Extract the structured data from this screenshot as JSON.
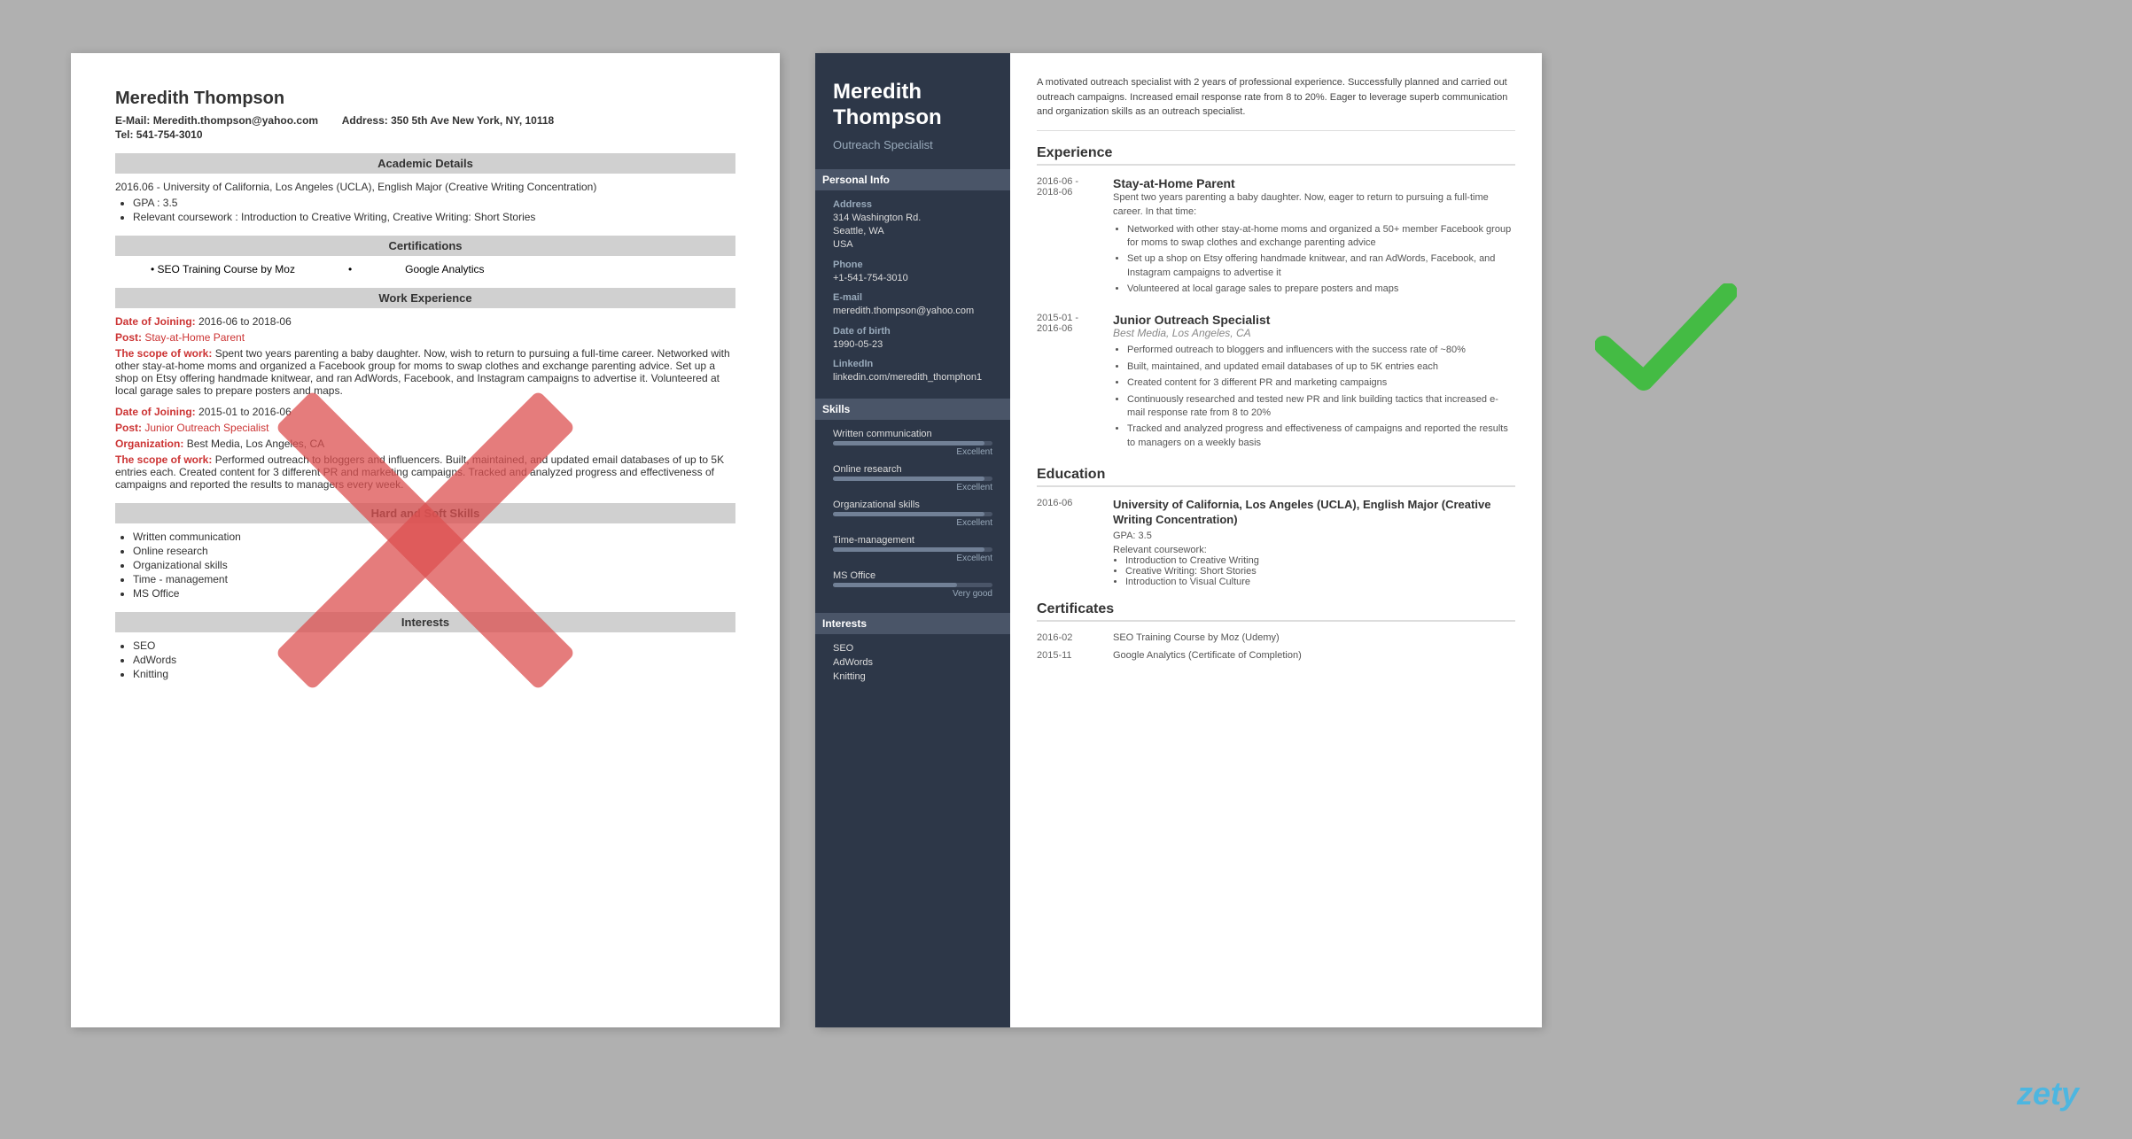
{
  "left_resume": {
    "name": "Meredith Thompson",
    "email_label": "E-Mail:",
    "email": "Meredith.thompson@yahoo.com",
    "address_label": "Address:",
    "address": "350 5th Ave New York, NY, 10118",
    "tel_label": "Tel:",
    "tel": "541-754-3010",
    "sections": {
      "academic": "Academic Details",
      "certifications": "Certifications",
      "work_experience": "Work Experience",
      "hard_soft_skills": "Hard and Soft Skills",
      "interests": "Interests"
    },
    "academic_details": "2016.06 - University of California, Los Angeles (UCLA), English Major (Creative Writing Concentration)",
    "gpa": "GPA : 3.5",
    "coursework": "Relevant coursework : Introduction to Creative Writing, Creative Writing: Short Stories",
    "certs": [
      "SEO Training Course by Moz",
      "Google Analytics"
    ],
    "work": [
      {
        "date_label": "Date of Joining:",
        "date": "2016-06 to 2018-06",
        "post_label": "Post:",
        "post": "Stay-at-Home Parent",
        "scope_label": "The scope of work:",
        "scope": "Spent two years parenting a baby daughter. Now, wish to return to pursuing a full-time career. Networked with other stay-at-home moms and organized a Facebook group for moms to swap clothes and exchange parenting advice. Set up a shop on Etsy offering handmade knitwear, and ran AdWords, Facebook, and Instagram campaigns to advertise it. Volunteered at local garage sales to prepare posters and maps."
      },
      {
        "date_label": "Date of Joining:",
        "date": "2015-01 to 2016-06",
        "post_label": "Post:",
        "post": "Junior Outreach Specialist",
        "org_label": "Organization:",
        "org": "Best Media, Los Angeles, CA",
        "scope_label": "The scope of work:",
        "scope": "Performed outreach to bloggers and influencers. Built, maintained, and updated email databases of up to 5K entries each. Created content for 3 different PR and marketing campaigns. Tracked and analyzed progress and effectiveness of campaigns and reported the results to managers every week."
      }
    ],
    "skills": [
      "Written communication",
      "Online research",
      "Organizational skills",
      "Time - management",
      "MS Office"
    ],
    "interests": [
      "SEO",
      "AdWords",
      "Knitting"
    ]
  },
  "right_resume": {
    "name": "Meredith Thompson",
    "title": "Outreach Specialist",
    "summary": "A motivated outreach specialist with 2 years of professional experience. Successfully planned and carried out outreach campaigns. Increased email response rate from 8 to 20%. Eager to leverage superb communication and organization skills as an outreach specialist.",
    "sidebar": {
      "personal_info_title": "Personal Info",
      "address_label": "Address",
      "address_lines": [
        "314 Washington Rd.",
        "Seattle, WA",
        "USA"
      ],
      "phone_label": "Phone",
      "phone": "+1-541-754-3010",
      "email_label": "E-mail",
      "email": "meredith.thompson@yahoo.com",
      "dob_label": "Date of birth",
      "dob": "1990-05-23",
      "linkedin_label": "LinkedIn",
      "linkedin": "linkedin.com/meredith_thomphon1",
      "skills_title": "Skills",
      "skills": [
        {
          "name": "Written communication",
          "level": "Excellent",
          "pct": 95
        },
        {
          "name": "Online research",
          "level": "Excellent",
          "pct": 95
        },
        {
          "name": "Organizational skills",
          "level": "Excellent",
          "pct": 95
        },
        {
          "name": "Time-management",
          "level": "Excellent",
          "pct": 95
        },
        {
          "name": "MS Office",
          "level": "Very good",
          "pct": 80
        }
      ],
      "interests_title": "Interests",
      "interests": [
        "SEO",
        "AdWords",
        "Knitting"
      ]
    },
    "experience_title": "Experience",
    "jobs": [
      {
        "date_start": "2016-06 -",
        "date_end": "2018-06",
        "title": "Stay-at-Home Parent",
        "company": "",
        "desc": "Spent two years parenting a baby daughter. Now, eager to return to pursuing a full-time career. In that time:",
        "bullets": [
          "Networked with other stay-at-home moms and organized a 50+ member Facebook group for moms to swap clothes and exchange parenting advice",
          "Set up a shop on Etsy offering handmade knitwear, and ran AdWords, Facebook, and Instagram campaigns to advertise it",
          "Volunteered at local garage sales to prepare posters and maps"
        ]
      },
      {
        "date_start": "2015-01 -",
        "date_end": "2016-06",
        "title": "Junior Outreach Specialist",
        "company": "Best Media, Los Angeles, CA",
        "desc": "",
        "bullets": [
          "Performed outreach to bloggers and influencers with the success rate of ~80%",
          "Built, maintained, and updated email databases of up to 5K entries each",
          "Created content for 3 different PR and marketing campaigns",
          "Continuously researched and tested new PR and link building tactics that increased e-mail response rate from 8 to 20%",
          "Tracked and analyzed progress and effectiveness of campaigns and reported the results to managers on a weekly basis"
        ]
      }
    ],
    "education_title": "Education",
    "education": [
      {
        "date": "2016-06",
        "school": "University of California, Los Angeles (UCLA), English Major (Creative Writing Concentration)",
        "gpa": "GPA: 3.5",
        "coursework_label": "Relevant coursework:",
        "coursework": [
          "Introduction to Creative Writing",
          "Creative Writing: Short Stories",
          "Introduction to Visual Culture"
        ]
      }
    ],
    "certificates_title": "Certificates",
    "certificates": [
      {
        "date": "2016-02",
        "name": "SEO Training Course by Moz (Udemy)"
      },
      {
        "date": "2015-11",
        "name": "Google Analytics (Certificate of Completion)"
      }
    ]
  },
  "watermark": "zety"
}
